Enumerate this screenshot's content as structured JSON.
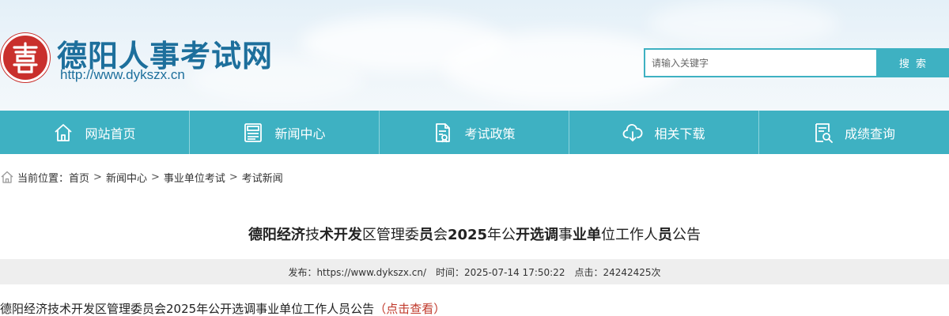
{
  "header": {
    "site_name": "德阳人事考试网",
    "site_url": "http://www.dykszx.cn",
    "search_placeholder": "请输入关键字",
    "search_button": "搜 索"
  },
  "nav": {
    "items": [
      {
        "label": "网站首页",
        "icon": "home-icon"
      },
      {
        "label": "新闻中心",
        "icon": "news-icon"
      },
      {
        "label": "考试政策",
        "icon": "policy-document-icon"
      },
      {
        "label": "相关下载",
        "icon": "cloud-download-icon"
      },
      {
        "label": "成绩查询",
        "icon": "score-search-icon"
      }
    ]
  },
  "breadcrumb": {
    "prefix": "当前位置：",
    "items": [
      "首页",
      "新闻中心",
      "事业单位考试",
      "考试新闻"
    ],
    "separator": ">"
  },
  "article": {
    "title_parts": [
      {
        "text": "德阳经济",
        "bold": true
      },
      {
        "text": "技",
        "bold": false
      },
      {
        "text": "术开发",
        "bold": true
      },
      {
        "text": "区管理委",
        "bold": false
      },
      {
        "text": "员",
        "bold": true
      },
      {
        "text": "会",
        "bold": false
      },
      {
        "text": "2025",
        "bold": true
      },
      {
        "text": "年公",
        "bold": false
      },
      {
        "text": "开选调",
        "bold": true
      },
      {
        "text": "事",
        "bold": false
      },
      {
        "text": "业单",
        "bold": true
      },
      {
        "text": "位工作人",
        "bold": false
      },
      {
        "text": "员",
        "bold": true
      },
      {
        "text": "公告",
        "bold": false
      }
    ],
    "meta": {
      "publisher": "发布：https://www.dykszx.cn/",
      "time": "时间：2025-07-14 17:50:22",
      "clicks": "点击：24242425次"
    },
    "content_text": "德阳经济技术开发区管理委员会2025年公开选调事业单位工作人员公告",
    "content_link": "（点击查看）"
  },
  "colors": {
    "accent": "#3eb1c2",
    "brand_text": "#1d6f9c",
    "logo_red": "#c9302c",
    "link_red": "#c0392b"
  }
}
